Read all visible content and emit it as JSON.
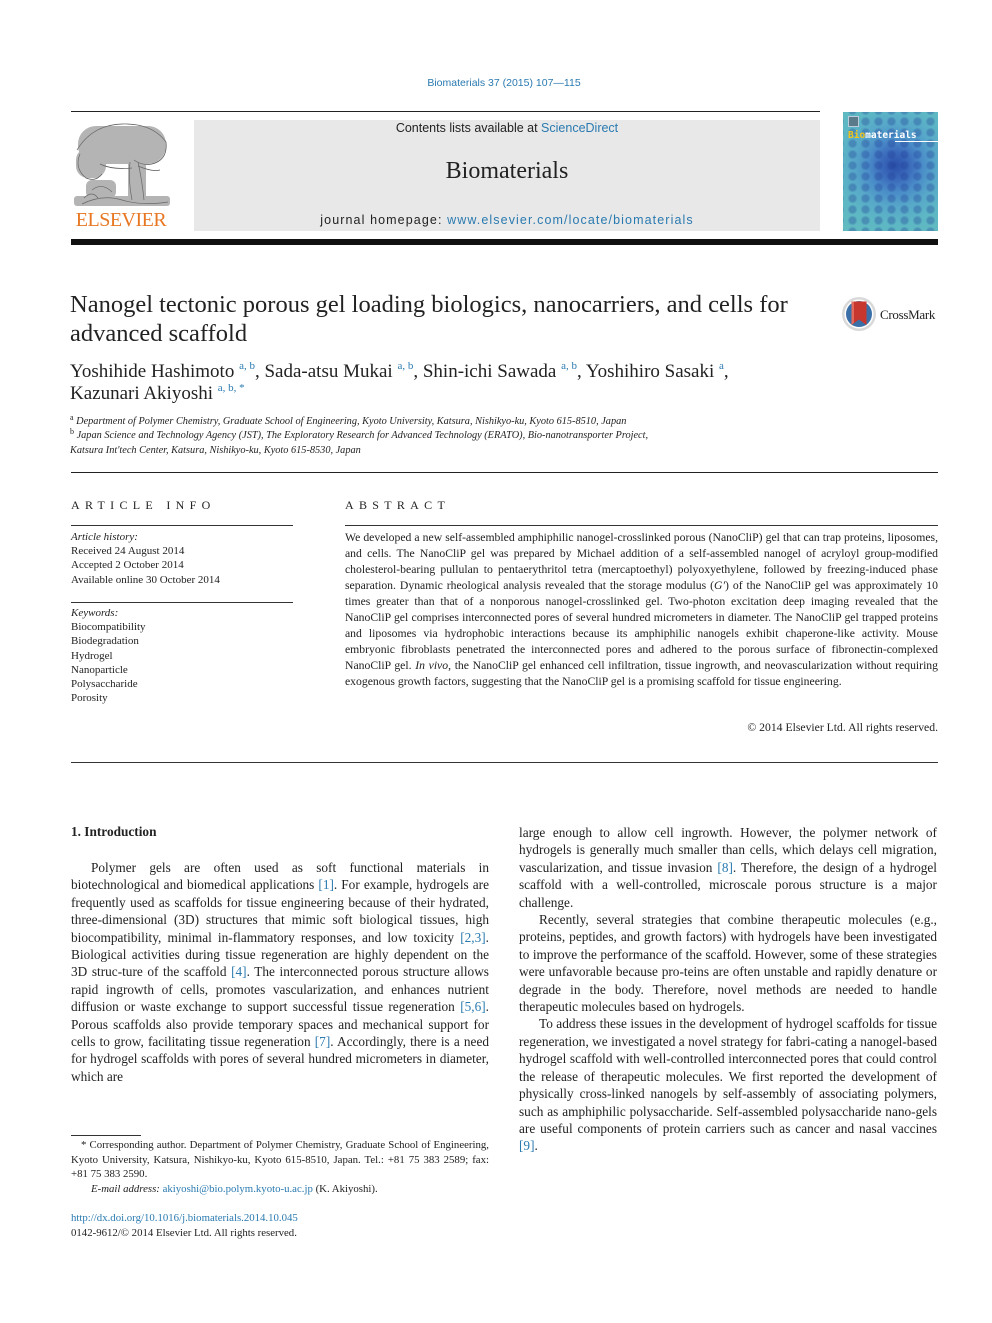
{
  "header": {
    "citation": "Biomaterials 37 (2015) 107—115",
    "publisher_logo_text": "ELSEVIER",
    "contents_prefix": "Contents lists available at ",
    "contents_link": "ScienceDirect",
    "journal_name": "Biomaterials",
    "homepage_prefix": "journal homepage: ",
    "homepage_link": "www.elsevier.com/locate/biomaterials",
    "cover_title_accent": "Bio",
    "cover_title_rest": "materials",
    "colors": {
      "link": "#2a7ab0",
      "elsevier_orange": "#e87722",
      "banner_bg": "#e8e8e8"
    }
  },
  "article": {
    "title": "Nanogel tectonic porous gel loading biologics, nanocarriers, and cells for advanced scaffold",
    "crossmark_label": "CrossMark",
    "authors": [
      {
        "name": "Yoshihide Hashimoto",
        "affils": "a, b",
        "sep": ", "
      },
      {
        "name": "Sada-atsu Mukai",
        "affils": "a, b",
        "sep": ", "
      },
      {
        "name": "Shin-ichi Sawada",
        "affils": "a, b",
        "sep": ", "
      },
      {
        "name": "Yoshihiro Sasaki",
        "affils": "a",
        "sep": ","
      },
      {
        "name": "Kazunari Akiyoshi",
        "affils": "a, b, *",
        "sep": ""
      }
    ],
    "affiliations": [
      {
        "mark": "a",
        "text": "Department of Polymer Chemistry, Graduate School of Engineering, Kyoto University, Katsura, Nishikyo-ku, Kyoto 615-8510, Japan"
      },
      {
        "mark": "b",
        "text": "Japan Science and Technology Agency (JST), The Exploratory Research for Advanced Technology (ERATO), Bio-nanotransporter Project,"
      },
      {
        "mark": "",
        "text": "Katsura Int'tech Center, Katsura, Nishikyo-ku, Kyoto 615-8530, Japan"
      }
    ]
  },
  "article_info": {
    "heading": "ARTICLE INFO",
    "history_label": "Article history:",
    "history": [
      "Received 24 August 2014",
      "Accepted 2 October 2014",
      "Available online 30 October 2014"
    ],
    "keywords_label": "Keywords:",
    "keywords": [
      "Biocompatibility",
      "Biodegradation",
      "Hydrogel",
      "Nanoparticle",
      "Polysaccharide",
      "Porosity"
    ]
  },
  "abstract": {
    "heading": "ABSTRACT",
    "text_1": "We developed a new self-assembled amphiphilic nanogel-crosslinked porous (NanoCliP) gel that can trap proteins, liposomes, and cells. The NanoCliP gel was prepared by Michael addition of a self-assembled nanogel of acryloyl group-modified cholesterol-bearing pullulan to pentaerythritol tetra (mercaptoethyl) polyoxyethylene, followed by freezing-induced phase separation. Dynamic rheological analysis revealed that the storage modulus (",
    "text_g": "G′",
    "text_2": ") of the NanoCliP gel was approximately 10 times greater than that of a nonporous nanogel-crosslinked gel. Two-photon excitation deep imaging revealed that the NanoCliP gel comprises interconnected pores of several hundred micrometers in diameter. The NanoCliP gel trapped proteins and liposomes via hydrophobic interactions because its amphiphilic nanogels exhibit chaperone-like activity. Mouse embryonic fibroblasts penetrated the interconnected pores and adhered to the porous surface of fibronectin-complexed NanoCliP gel. ",
    "text_invivo": "In vivo",
    "text_3": ", the NanoCliP gel enhanced cell infiltration, tissue ingrowth, and neovascularization without requiring exogenous growth factors, suggesting that the NanoCliP gel is a promising scaffold for tissue engineering.",
    "copyright": "© 2014 Elsevier Ltd. All rights reserved."
  },
  "body": {
    "section_heading": "1.  Introduction",
    "left_para": [
      {
        "t": "Polymer gels are often used as soft functional materials in biotechnological and biomedical applications "
      },
      {
        "r": "[1]"
      },
      {
        "t": ". For example, hydrogels are frequently used as scaffolds for tissue engineering because of their hydrated, three-dimensional (3D) structures that mimic soft biological tissues, high biocompatibility, minimal in-flammatory responses, and low toxicity "
      },
      {
        "r": "[2,3]"
      },
      {
        "t": ". Biological activities during tissue regeneration are highly dependent on the 3D struc-ture of the scaffold "
      },
      {
        "r": "[4]"
      },
      {
        "t": ". The interconnected porous structure allows rapid ingrowth of cells, promotes vascularization, and enhances nutrient diffusion or waste exchange to support successful tissue regeneration "
      },
      {
        "r": "[5,6]"
      },
      {
        "t": ". Porous scaffolds also provide temporary spaces and mechanical support for cells to grow, facilitating tissue regeneration "
      },
      {
        "r": "[7]"
      },
      {
        "t": ". Accordingly, there is a need for hydrogel scaffolds with pores of several hundred micrometers in diameter, which are"
      }
    ],
    "right_para_1": [
      {
        "t": "large enough to allow cell ingrowth. However, the polymer network of hydrogels is generally much smaller than cells, which delays cell migration, vascularization, and tissue invasion "
      },
      {
        "r": "[8]"
      },
      {
        "t": ". Therefore, the design of a hydrogel scaffold with a well-controlled, microscale porous structure is a major challenge."
      }
    ],
    "right_para_2": [
      {
        "t": "Recently, several strategies that combine therapeutic molecules (e.g., proteins, peptides, and growth factors) with hydrogels have been investigated to improve the performance of the scaffold. However, some of these strategies were unfavorable because pro-teins are often unstable and rapidly denature or degrade in the body. Therefore, novel methods are needed to handle therapeutic molecules based on hydrogels."
      }
    ],
    "right_para_3": [
      {
        "t": "To address these issues in the development of hydrogel scaffolds for tissue regeneration, we investigated a novel strategy for fabri-cating a nanogel-based hydrogel scaffold with well-controlled interconnected pores that could control the release of therapeutic molecules. We first reported the development of physically cross-linked nanogels by self-assembly of associating polymers, such as amphiphilic polysaccharide. Self-assembled polysaccharide nano-gels are useful components of protein carriers such as cancer and nasal vaccines "
      },
      {
        "r": "[9]"
      },
      {
        "t": "."
      }
    ]
  },
  "footnote": {
    "corresponding": "* Corresponding author. Department of Polymer Chemistry, Graduate School of Engineering, Kyoto University, Katsura, Nishikyo-ku, Kyoto 615-8510, Japan. Tel.: +81 75 383 2589; fax: +81 75 383 2590.",
    "email_label": "E-mail address: ",
    "email": "akiyoshi@bio.polym.kyoto-u.ac.jp",
    "email_suffix": " (K. Akiyoshi).",
    "doi": "http://dx.doi.org/10.1016/j.biomaterials.2014.10.045",
    "issn_line": "0142-9612/© 2014 Elsevier Ltd. All rights reserved."
  }
}
